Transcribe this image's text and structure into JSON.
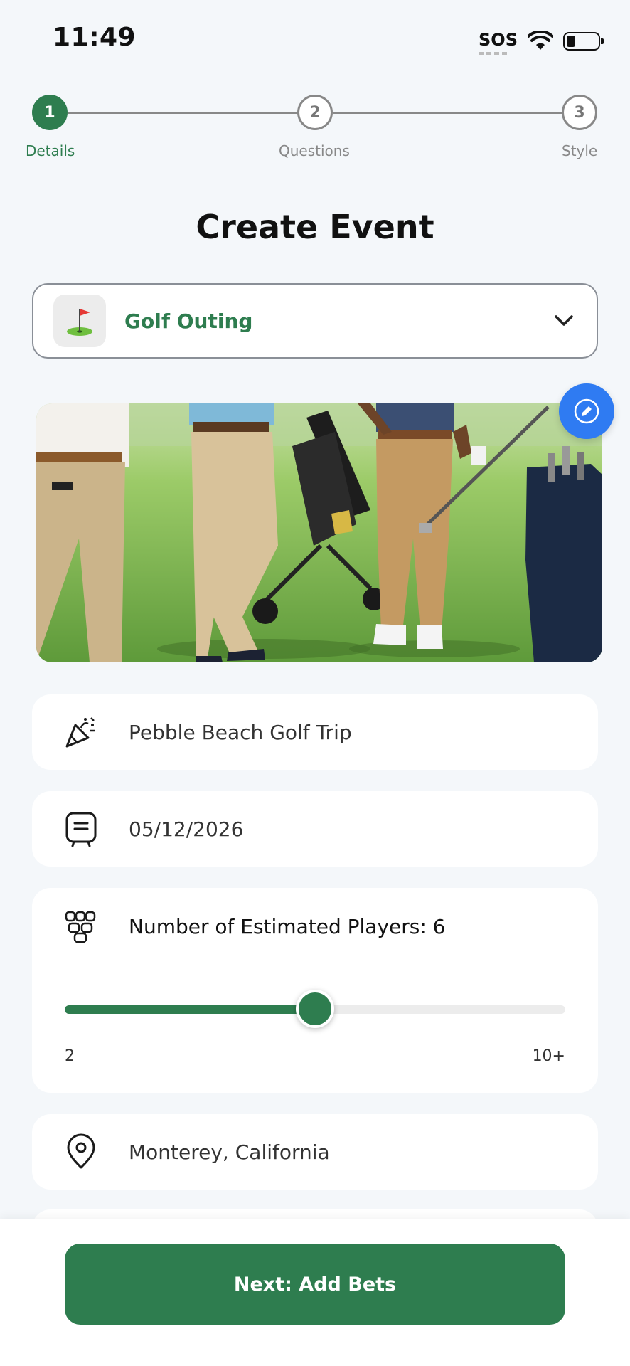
{
  "status_bar": {
    "time": "11:49",
    "sos": "SOS"
  },
  "stepper": {
    "steps": [
      {
        "number": "1",
        "label": "Details"
      },
      {
        "number": "2",
        "label": "Questions"
      },
      {
        "number": "3",
        "label": "Style"
      }
    ],
    "active_index": 0
  },
  "page_title": "Create Event",
  "category": {
    "label": "Golf Outing",
    "icon": "golf-flag-icon"
  },
  "hero_image": {
    "edit_icon": "pencil-icon"
  },
  "fields": {
    "event_name": {
      "value": "Pebble Beach Golf Trip",
      "icon": "party-popper-icon"
    },
    "date": {
      "value": "05/12/2026",
      "icon": "calendar-icon"
    },
    "location": {
      "value": "Monterey, California",
      "icon": "location-pin-icon"
    }
  },
  "players": {
    "label": "Number of Estimated Players: 6",
    "icon": "group-icon",
    "min_label": "2",
    "max_label": "10+",
    "value": 6,
    "min": 2,
    "max": 10
  },
  "footer": {
    "next_label": "Next: Add Bets"
  },
  "colors": {
    "primary": "#2e7d4f",
    "accent_blue": "#2f7bf2",
    "background": "#f4f7fa"
  }
}
